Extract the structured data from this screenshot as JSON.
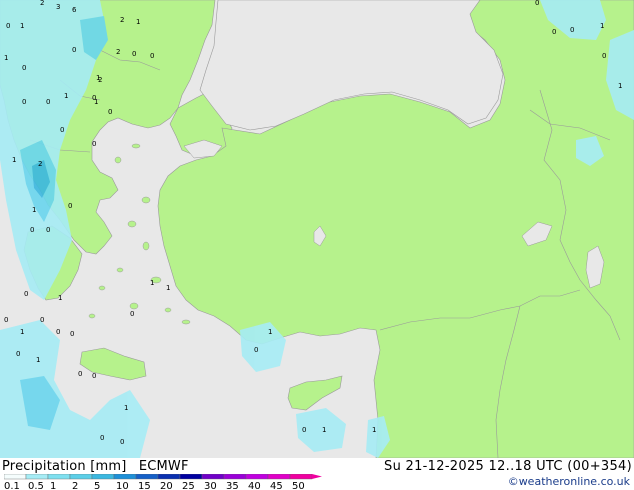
{
  "map": {
    "colors": {
      "sea": "#e8e8e8",
      "land": "#b6f28c",
      "border": "#9a9a9a",
      "precip_light": "#a6ecf5",
      "precip_mid": "#6ad6ee",
      "precip_heavy": "#3cb8e0"
    },
    "point_labels": [
      "2",
      "3",
      "6",
      "1",
      "2",
      "1",
      "0",
      "0",
      "1",
      "0",
      "2",
      "2",
      "0",
      "1",
      "0",
      "0",
      "1",
      "0",
      "2",
      "1",
      "0",
      "0",
      "0",
      "0",
      "1",
      "0",
      "1",
      "1",
      "1",
      "0",
      "0",
      "0",
      "1",
      "0",
      "0",
      "0",
      "1",
      "0",
      "0",
      "1",
      "1",
      "0",
      "0",
      "1",
      "0",
      "0",
      "1",
      "0",
      "0",
      "0",
      "0",
      "1",
      "1",
      "0",
      "1",
      "0",
      "0"
    ]
  },
  "footer": {
    "title": "Precipitation [mm]",
    "model": "ECMWF",
    "run_info": "Su 21-12-2025 12..18 UTC (00+354)",
    "credit": "©weatheronline.co.uk",
    "scale_labels": [
      "0.1",
      "0.5",
      "1",
      "2",
      "5",
      "10",
      "15",
      "20",
      "25",
      "30",
      "35",
      "40",
      "45",
      "50"
    ],
    "scale_colors": [
      "#f5fdfd",
      "#a6ecf5",
      "#7fe0f0",
      "#5ccfe8",
      "#3cb8e0",
      "#1e90d8",
      "#1560c8",
      "#0a30b0",
      "#0000a0",
      "#7000c8",
      "#9a00d8",
      "#c000e0",
      "#e000c8",
      "#f000a0"
    ]
  }
}
